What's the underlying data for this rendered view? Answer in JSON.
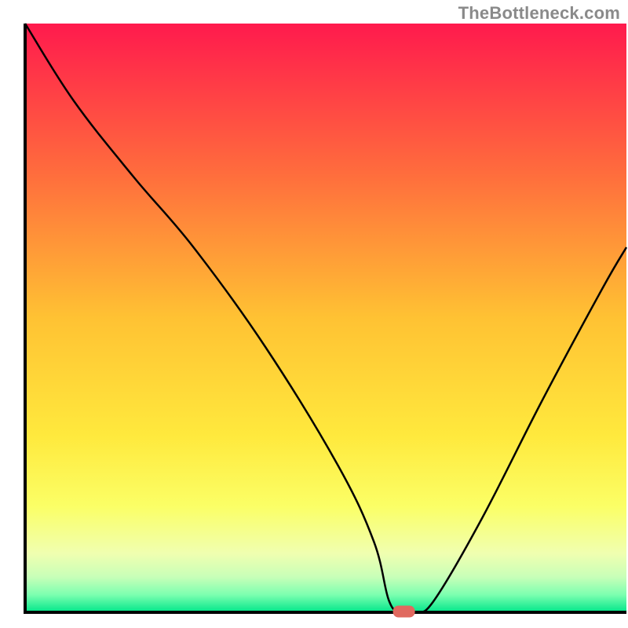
{
  "watermark": "TheBottleneck.com",
  "chart_data": {
    "type": "line",
    "title": "",
    "xlabel": "",
    "ylabel": "",
    "xlim": [
      0,
      100
    ],
    "ylim": [
      0,
      100
    ],
    "background_gradient": {
      "type": "vertical",
      "stops": [
        {
          "pos": 0.0,
          "color": "#ff1a4d"
        },
        {
          "pos": 0.25,
          "color": "#ff6b3d"
        },
        {
          "pos": 0.5,
          "color": "#ffc233"
        },
        {
          "pos": 0.7,
          "color": "#ffe93d"
        },
        {
          "pos": 0.82,
          "color": "#fbff66"
        },
        {
          "pos": 0.9,
          "color": "#f0ffb0"
        },
        {
          "pos": 0.94,
          "color": "#c8ffb8"
        },
        {
          "pos": 0.97,
          "color": "#7dffb0"
        },
        {
          "pos": 1.0,
          "color": "#00e68a"
        }
      ]
    },
    "series": [
      {
        "name": "bottleneck-curve",
        "x": [
          0,
          8,
          18,
          28,
          40,
          52,
          58,
          60.5,
          62.5,
          65,
          68,
          76,
          86,
          96,
          100
        ],
        "y": [
          100,
          87,
          74,
          62,
          45,
          25,
          12,
          2,
          0,
          0,
          2,
          16,
          36,
          55,
          62
        ]
      }
    ],
    "marker": {
      "name": "bottleneck-point",
      "x": 63,
      "y": 0,
      "color": "#e0695f",
      "label": ""
    },
    "axes_visible": true,
    "grid": false
  }
}
